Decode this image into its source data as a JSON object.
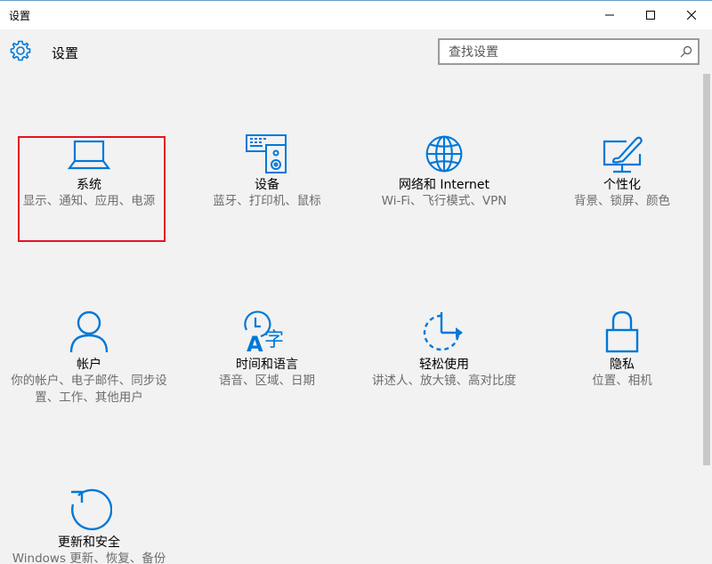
{
  "window": {
    "title": "设置",
    "controls": {
      "minimize": "minimize-icon",
      "maximize": "maximize-icon",
      "close": "close-icon"
    }
  },
  "header": {
    "title": "设置",
    "search_placeholder": "查找设置",
    "search_value": ""
  },
  "accent": "#0078d7",
  "tiles": [
    {
      "name": "系统",
      "desc": "显示、通知、应用、电源",
      "icon": "laptop-icon"
    },
    {
      "name": "设备",
      "desc": "蓝牙、打印机、鼠标",
      "icon": "devices-icon"
    },
    {
      "name": "网络和 Internet",
      "desc": "Wi-Fi、飞行模式、VPN",
      "icon": "globe-icon"
    },
    {
      "name": "个性化",
      "desc": "背景、锁屏、颜色",
      "icon": "personalization-icon"
    },
    {
      "name": "帐户",
      "desc": "你的帐户、电子邮件、同步设置、工作、其他用户",
      "icon": "person-icon"
    },
    {
      "name": "时间和语言",
      "desc": "语音、区域、日期",
      "icon": "time-language-icon"
    },
    {
      "name": "轻松使用",
      "desc": "讲述人、放大镜、高对比度",
      "icon": "ease-of-access-icon"
    },
    {
      "name": "隐私",
      "desc": "位置、相机",
      "icon": "lock-icon"
    },
    {
      "name": "更新和安全",
      "desc": "Windows 更新、恢复、备份",
      "icon": "update-icon"
    }
  ]
}
